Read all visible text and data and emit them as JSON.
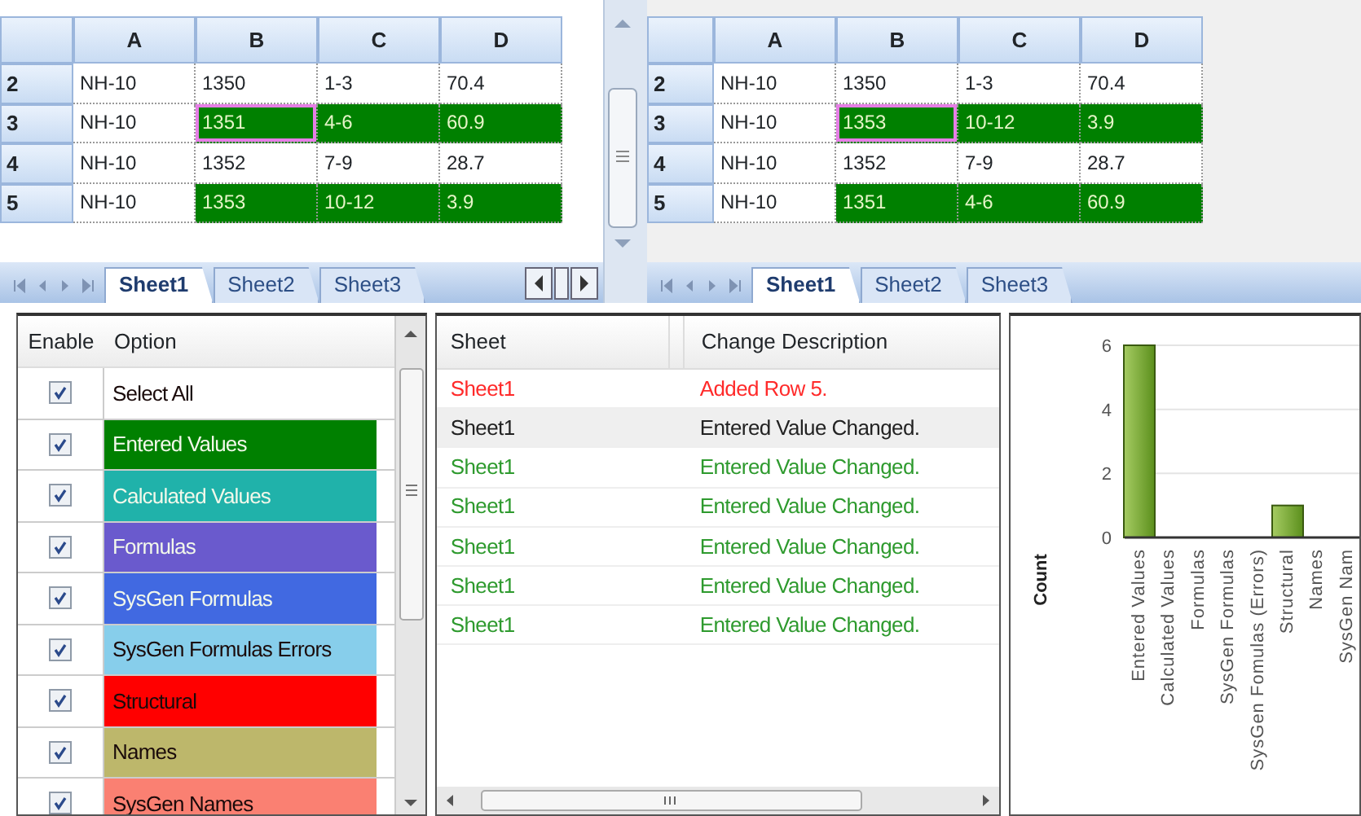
{
  "sheets": [
    {
      "columns": [
        "A",
        "B",
        "C",
        "D"
      ],
      "tabs": [
        {
          "label": "Sheet1",
          "selected": true
        },
        {
          "label": "Sheet2",
          "selected": false
        },
        {
          "label": "Sheet3",
          "selected": false
        }
      ],
      "rows": [
        {
          "header": "2",
          "cells": [
            {
              "value": "NH-10",
              "highlighted": false,
              "selected": false
            },
            {
              "value": "1350",
              "highlighted": false,
              "selected": false
            },
            {
              "value": "1-3",
              "highlighted": false,
              "selected": false
            },
            {
              "value": "70.4",
              "highlighted": false,
              "selected": false
            }
          ]
        },
        {
          "header": "3",
          "cells": [
            {
              "value": "NH-10",
              "highlighted": false,
              "selected": false
            },
            {
              "value": "1351",
              "highlighted": true,
              "selected": true
            },
            {
              "value": "4-6",
              "highlighted": true,
              "selected": false
            },
            {
              "value": "60.9",
              "highlighted": true,
              "selected": false
            }
          ]
        },
        {
          "header": "4",
          "cells": [
            {
              "value": "NH-10",
              "highlighted": false,
              "selected": false
            },
            {
              "value": "1352",
              "highlighted": false,
              "selected": false
            },
            {
              "value": "7-9",
              "highlighted": false,
              "selected": false
            },
            {
              "value": "28.7",
              "highlighted": false,
              "selected": false
            }
          ]
        },
        {
          "header": "5",
          "cells": [
            {
              "value": "NH-10",
              "highlighted": false,
              "selected": false
            },
            {
              "value": "1353",
              "highlighted": true,
              "selected": false
            },
            {
              "value": "10-12",
              "highlighted": true,
              "selected": false
            },
            {
              "value": "3.9",
              "highlighted": true,
              "selected": false
            }
          ]
        }
      ]
    },
    {
      "columns": [
        "A",
        "B",
        "C",
        "D"
      ],
      "tabs": [
        {
          "label": "Sheet1",
          "selected": true
        },
        {
          "label": "Sheet2",
          "selected": false
        },
        {
          "label": "Sheet3",
          "selected": false
        }
      ],
      "rows": [
        {
          "header": "2",
          "cells": [
            {
              "value": "NH-10",
              "highlighted": false,
              "selected": false
            },
            {
              "value": "1350",
              "highlighted": false,
              "selected": false
            },
            {
              "value": "1-3",
              "highlighted": false,
              "selected": false
            },
            {
              "value": "70.4",
              "highlighted": false,
              "selected": false
            }
          ]
        },
        {
          "header": "3",
          "cells": [
            {
              "value": "NH-10",
              "highlighted": false,
              "selected": false
            },
            {
              "value": "1353",
              "highlighted": true,
              "selected": true
            },
            {
              "value": "10-12",
              "highlighted": true,
              "selected": false
            },
            {
              "value": "3.9",
              "highlighted": true,
              "selected": false
            }
          ]
        },
        {
          "header": "4",
          "cells": [
            {
              "value": "NH-10",
              "highlighted": false,
              "selected": false
            },
            {
              "value": "1352",
              "highlighted": false,
              "selected": false
            },
            {
              "value": "7-9",
              "highlighted": false,
              "selected": false
            },
            {
              "value": "28.7",
              "highlighted": false,
              "selected": false
            }
          ]
        },
        {
          "header": "5",
          "cells": [
            {
              "value": "NH-10",
              "highlighted": false,
              "selected": false
            },
            {
              "value": "1351",
              "highlighted": true,
              "selected": false
            },
            {
              "value": "4-6",
              "highlighted": true,
              "selected": false
            },
            {
              "value": "60.9",
              "highlighted": true,
              "selected": false
            }
          ]
        }
      ]
    }
  ],
  "options": {
    "columns": [
      "Enable",
      "Option"
    ],
    "items": [
      {
        "label": "Select All",
        "checked": true,
        "color": "#ffffff",
        "light_text": false
      },
      {
        "label": "Entered Values",
        "checked": true,
        "color": "#008000",
        "light_text": true
      },
      {
        "label": "Calculated Values",
        "checked": true,
        "color": "#20b2aa",
        "light_text": true
      },
      {
        "label": "Formulas",
        "checked": true,
        "color": "#6a5acd",
        "light_text": true
      },
      {
        "label": "SysGen Formulas",
        "checked": true,
        "color": "#4169e1",
        "light_text": true
      },
      {
        "label": "SysGen Formulas Errors",
        "checked": true,
        "color": "#87ceeb",
        "light_text": false
      },
      {
        "label": "Structural",
        "checked": true,
        "color": "#ff0000",
        "light_text": false
      },
      {
        "label": "Names",
        "checked": true,
        "color": "#bdb76b",
        "light_text": false
      },
      {
        "label": "SysGen Names",
        "checked": true,
        "color": "#fa8072",
        "light_text": false
      }
    ]
  },
  "changes": {
    "columns": [
      "Sheet",
      "Change Description"
    ],
    "rows": [
      {
        "sheet": "Sheet1",
        "description": "Added Row 5.",
        "color": "#ff2a2a",
        "selected": false
      },
      {
        "sheet": "Sheet1",
        "description": "Entered Value Changed.",
        "color": "#222222",
        "selected": true
      },
      {
        "sheet": "Sheet1",
        "description": "Entered Value Changed.",
        "color": "#2e9a2e",
        "selected": false
      },
      {
        "sheet": "Sheet1",
        "description": "Entered Value Changed.",
        "color": "#2e9a2e",
        "selected": false
      },
      {
        "sheet": "Sheet1",
        "description": "Entered Value Changed.",
        "color": "#2e9a2e",
        "selected": false
      },
      {
        "sheet": "Sheet1",
        "description": "Entered Value Changed.",
        "color": "#2e9a2e",
        "selected": false
      },
      {
        "sheet": "Sheet1",
        "description": "Entered Value Changed.",
        "color": "#2e9a2e",
        "selected": false
      }
    ]
  },
  "chart": {
    "chart_data": {
      "type": "bar",
      "ylabel": "Count",
      "categories": [
        "Entered Values",
        "Calculated Values",
        "Formulas",
        "SysGen Formulas",
        "SysGen Fomulas (Errors)",
        "Structural",
        "Names",
        "SysGen Nam"
      ],
      "values": [
        6,
        0,
        0,
        0,
        0,
        1,
        0,
        null
      ],
      "ylim": [
        0,
        6
      ],
      "yticks": [
        0,
        2,
        4,
        6
      ]
    }
  }
}
